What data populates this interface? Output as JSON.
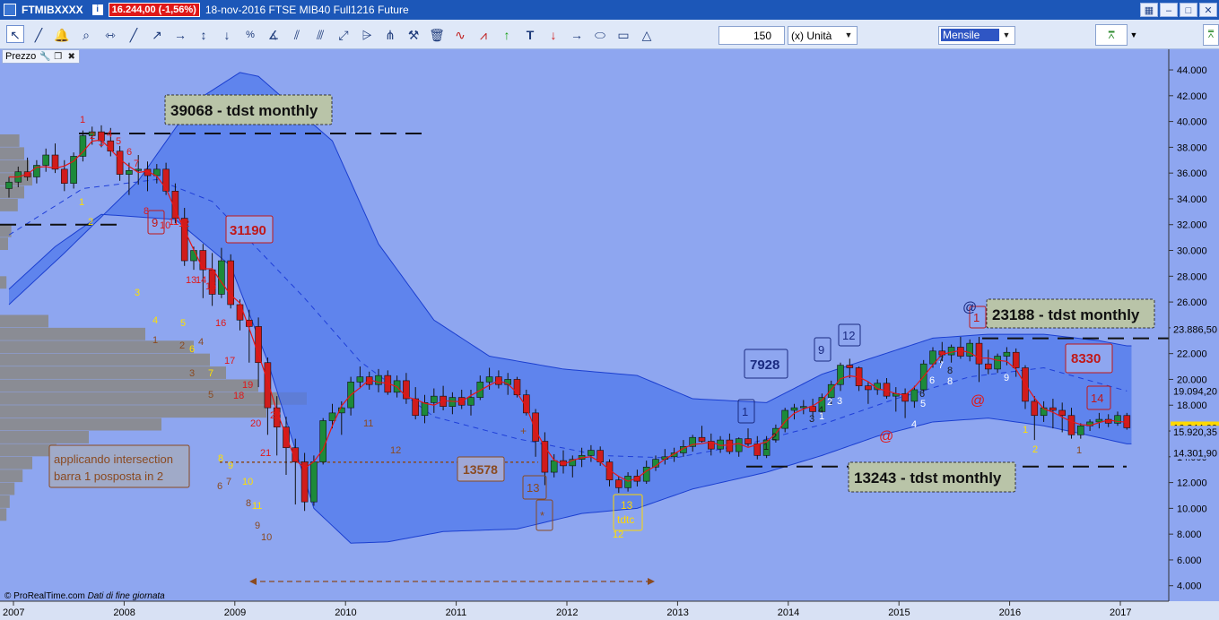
{
  "titlebar": {
    "symbol": "FTMIBXXXX",
    "price_badge": "16.244,00 (-1,56%)",
    "title": "18-nov-2016 FTSE MIB40 Full1216 Future",
    "window_buttons": [
      "▦",
      "–",
      "□",
      "✕"
    ]
  },
  "toolbar": {
    "units_value": "150",
    "units_label": "(x) Unità",
    "period": "Mensile",
    "tools": [
      "cursor-icon",
      "ruler-icon",
      "alarm-icon",
      "zoom-icon",
      "horizontal-line-icon",
      "trendline-icon",
      "ray-icon",
      "horizontal-ray-icon",
      "vertical-line-icon",
      "vertical-ray-icon",
      "percent-icon",
      "fibonacci-icon",
      "fan-icon",
      "channel-icon",
      "arrows-icon",
      "regression-icon",
      "pitchfork-icon",
      "tools-icon",
      "trash-icon",
      "wave-icon",
      "zigzag-icon",
      "up-arrow-icon",
      "text-icon",
      "down-arrow-icon",
      "right-arrow-icon",
      "ellipse-icon",
      "rectangle-icon",
      "triangle-icon"
    ]
  },
  "panel": {
    "label": "Prezzo"
  },
  "chart_data": {
    "type": "candlestick",
    "instrument": "FTSE MIB40 Full1216 Future",
    "period": "Mensile",
    "x_ticks": [
      "2007",
      "2008",
      "2009",
      "2010",
      "2011",
      "2012",
      "2013",
      "2014",
      "2015",
      "2016",
      "2017"
    ],
    "y_ticks": [
      "4.000",
      "6.000",
      "8.000",
      "10.000",
      "12.000",
      "14.000",
      "16.000",
      "18.000",
      "20.000",
      "22.000",
      "24.000",
      "26.000",
      "28.000",
      "30.000",
      "32.000",
      "34.000",
      "36.000",
      "38.000",
      "40.000",
      "42.000",
      "44.000"
    ],
    "ylim": [
      2800,
      45600
    ],
    "candles": [
      {
        "o": 34800,
        "h": 35700,
        "l": 34100,
        "c": 35300
      },
      {
        "o": 35300,
        "h": 36500,
        "l": 34900,
        "c": 36100
      },
      {
        "o": 36100,
        "h": 37200,
        "l": 35400,
        "c": 35700
      },
      {
        "o": 35700,
        "h": 37000,
        "l": 35200,
        "c": 36600
      },
      {
        "o": 36600,
        "h": 37900,
        "l": 36100,
        "c": 37400
      },
      {
        "o": 37400,
        "h": 38300,
        "l": 36000,
        "c": 36300
      },
      {
        "o": 36300,
        "h": 37000,
        "l": 34600,
        "c": 35200
      },
      {
        "o": 35200,
        "h": 37600,
        "l": 34800,
        "c": 37300
      },
      {
        "o": 37300,
        "h": 39300,
        "l": 36900,
        "c": 38900
      },
      {
        "o": 38900,
        "h": 39600,
        "l": 38200,
        "c": 39200
      },
      {
        "o": 39200,
        "h": 39700,
        "l": 38000,
        "c": 38500
      },
      {
        "o": 38500,
        "h": 39500,
        "l": 37300,
        "c": 37700
      },
      {
        "o": 37700,
        "h": 38100,
        "l": 35400,
        "c": 35900
      },
      {
        "o": 35900,
        "h": 36800,
        "l": 34300,
        "c": 36200
      },
      {
        "o": 36200,
        "h": 37400,
        "l": 35100,
        "c": 36300
      },
      {
        "o": 36300,
        "h": 36900,
        "l": 34600,
        "c": 35800
      },
      {
        "o": 35800,
        "h": 36700,
        "l": 35200,
        "c": 36300
      },
      {
        "o": 36300,
        "h": 36800,
        "l": 34300,
        "c": 34600
      },
      {
        "o": 34600,
        "h": 35200,
        "l": 32100,
        "c": 32500
      },
      {
        "o": 32500,
        "h": 33300,
        "l": 28800,
        "c": 29200
      },
      {
        "o": 29200,
        "h": 30300,
        "l": 28500,
        "c": 30000
      },
      {
        "o": 30000,
        "h": 30500,
        "l": 26300,
        "c": 28500
      },
      {
        "o": 28500,
        "h": 29800,
        "l": 25700,
        "c": 26600
      },
      {
        "o": 26600,
        "h": 30200,
        "l": 26300,
        "c": 29200
      },
      {
        "o": 29200,
        "h": 29700,
        "l": 25500,
        "c": 25800
      },
      {
        "o": 25800,
        "h": 26200,
        "l": 23800,
        "c": 24600
      },
      {
        "o": 24600,
        "h": 25400,
        "l": 21300,
        "c": 24100
      },
      {
        "o": 24100,
        "h": 24800,
        "l": 19400,
        "c": 21300
      },
      {
        "o": 21300,
        "h": 21700,
        "l": 15700,
        "c": 17800
      },
      {
        "o": 17800,
        "h": 18700,
        "l": 14100,
        "c": 16300
      },
      {
        "o": 16300,
        "h": 17100,
        "l": 12600,
        "c": 14700
      },
      {
        "o": 14700,
        "h": 15400,
        "l": 10300,
        "c": 13600
      },
      {
        "o": 13600,
        "h": 14300,
        "l": 9800,
        "c": 10500
      },
      {
        "o": 10500,
        "h": 14100,
        "l": 10200,
        "c": 13600
      },
      {
        "o": 13600,
        "h": 17000,
        "l": 13400,
        "c": 16800
      },
      {
        "o": 16800,
        "h": 18100,
        "l": 16200,
        "c": 17400
      },
      {
        "o": 17400,
        "h": 18300,
        "l": 15700,
        "c": 17800
      },
      {
        "o": 17800,
        "h": 20200,
        "l": 17200,
        "c": 19800
      },
      {
        "o": 19800,
        "h": 21000,
        "l": 19300,
        "c": 20200
      },
      {
        "o": 20200,
        "h": 20600,
        "l": 19200,
        "c": 19600
      },
      {
        "o": 19600,
        "h": 20800,
        "l": 19000,
        "c": 20300
      },
      {
        "o": 20300,
        "h": 20700,
        "l": 18800,
        "c": 19000
      },
      {
        "o": 19000,
        "h": 20300,
        "l": 18600,
        "c": 19900
      },
      {
        "o": 19900,
        "h": 20500,
        "l": 18100,
        "c": 18500
      },
      {
        "o": 18500,
        "h": 19400,
        "l": 16900,
        "c": 17200
      },
      {
        "o": 17200,
        "h": 18800,
        "l": 16600,
        "c": 18200
      },
      {
        "o": 18200,
        "h": 19300,
        "l": 17400,
        "c": 18700
      },
      {
        "o": 18700,
        "h": 19500,
        "l": 17600,
        "c": 17900
      },
      {
        "o": 17900,
        "h": 19000,
        "l": 17300,
        "c": 18600
      },
      {
        "o": 18600,
        "h": 19200,
        "l": 17700,
        "c": 18000
      },
      {
        "o": 18000,
        "h": 19200,
        "l": 17200,
        "c": 18600
      },
      {
        "o": 18600,
        "h": 20300,
        "l": 18400,
        "c": 19800
      },
      {
        "o": 19800,
        "h": 20900,
        "l": 19200,
        "c": 20200
      },
      {
        "o": 20200,
        "h": 20700,
        "l": 19300,
        "c": 19600
      },
      {
        "o": 19600,
        "h": 20500,
        "l": 18800,
        "c": 20000
      },
      {
        "o": 20000,
        "h": 20200,
        "l": 18600,
        "c": 18800
      },
      {
        "o": 18800,
        "h": 19200,
        "l": 17200,
        "c": 17400
      },
      {
        "o": 17400,
        "h": 17700,
        "l": 14000,
        "c": 15200
      },
      {
        "o": 15200,
        "h": 15900,
        "l": 11800,
        "c": 12800
      },
      {
        "o": 12800,
        "h": 14200,
        "l": 12400,
        "c": 13700
      },
      {
        "o": 13700,
        "h": 14500,
        "l": 12700,
        "c": 13300
      },
      {
        "o": 13300,
        "h": 14100,
        "l": 12400,
        "c": 13800
      },
      {
        "o": 13800,
        "h": 14700,
        "l": 13200,
        "c": 14100
      },
      {
        "o": 14100,
        "h": 14900,
        "l": 13600,
        "c": 14500
      },
      {
        "o": 14500,
        "h": 14800,
        "l": 13300,
        "c": 13600
      },
      {
        "o": 13600,
        "h": 13800,
        "l": 11700,
        "c": 12200
      },
      {
        "o": 12200,
        "h": 12500,
        "l": 11200,
        "c": 11600
      },
      {
        "o": 11600,
        "h": 12800,
        "l": 11300,
        "c": 12500
      },
      {
        "o": 12500,
        "h": 13000,
        "l": 11700,
        "c": 12100
      },
      {
        "o": 12100,
        "h": 13700,
        "l": 11900,
        "c": 13200
      },
      {
        "o": 13200,
        "h": 14100,
        "l": 12900,
        "c": 13800
      },
      {
        "o": 13800,
        "h": 14600,
        "l": 13400,
        "c": 14000
      },
      {
        "o": 14000,
        "h": 14700,
        "l": 13600,
        "c": 14300
      },
      {
        "o": 14300,
        "h": 15300,
        "l": 14000,
        "c": 14800
      },
      {
        "o": 14800,
        "h": 15700,
        "l": 14400,
        "c": 15500
      },
      {
        "o": 15500,
        "h": 16400,
        "l": 15100,
        "c": 15200
      },
      {
        "o": 15200,
        "h": 15800,
        "l": 14100,
        "c": 14600
      },
      {
        "o": 14600,
        "h": 15600,
        "l": 14300,
        "c": 15300
      },
      {
        "o": 15300,
        "h": 15800,
        "l": 14200,
        "c": 14400
      },
      {
        "o": 14400,
        "h": 15500,
        "l": 14000,
        "c": 15400
      },
      {
        "o": 15400,
        "h": 16200,
        "l": 14800,
        "c": 15000
      },
      {
        "o": 15000,
        "h": 15600,
        "l": 13800,
        "c": 14100
      },
      {
        "o": 14100,
        "h": 15600,
        "l": 13900,
        "c": 15300
      },
      {
        "o": 15300,
        "h": 16500,
        "l": 15100,
        "c": 16200
      },
      {
        "o": 16200,
        "h": 17800,
        "l": 15900,
        "c": 17600
      },
      {
        "o": 17600,
        "h": 18100,
        "l": 16900,
        "c": 17800
      },
      {
        "o": 17800,
        "h": 18400,
        "l": 17300,
        "c": 17900
      },
      {
        "o": 17900,
        "h": 18500,
        "l": 17100,
        "c": 17500
      },
      {
        "o": 17500,
        "h": 18900,
        "l": 17200,
        "c": 18600
      },
      {
        "o": 18600,
        "h": 19900,
        "l": 18000,
        "c": 19600
      },
      {
        "o": 19600,
        "h": 21300,
        "l": 19100,
        "c": 21100
      },
      {
        "o": 21100,
        "h": 21600,
        "l": 20100,
        "c": 20900
      },
      {
        "o": 20900,
        "h": 21000,
        "l": 19100,
        "c": 19500
      },
      {
        "o": 19500,
        "h": 19800,
        "l": 18100,
        "c": 19200
      },
      {
        "o": 19200,
        "h": 20000,
        "l": 18800,
        "c": 19700
      },
      {
        "o": 19700,
        "h": 20100,
        "l": 18500,
        "c": 18700
      },
      {
        "o": 18700,
        "h": 19400,
        "l": 17500,
        "c": 18900
      },
      {
        "o": 18900,
        "h": 19300,
        "l": 17000,
        "c": 18300
      },
      {
        "o": 18300,
        "h": 19500,
        "l": 17800,
        "c": 19200
      },
      {
        "o": 19200,
        "h": 21500,
        "l": 19000,
        "c": 21200
      },
      {
        "o": 21200,
        "h": 22500,
        "l": 20900,
        "c": 22200
      },
      {
        "o": 22200,
        "h": 22900,
        "l": 21400,
        "c": 21900
      },
      {
        "o": 21900,
        "h": 22700,
        "l": 21300,
        "c": 22500
      },
      {
        "o": 22500,
        "h": 23300,
        "l": 21600,
        "c": 21800
      },
      {
        "o": 21800,
        "h": 23100,
        "l": 21400,
        "c": 22800
      },
      {
        "o": 22800,
        "h": 23300,
        "l": 19800,
        "c": 21200
      },
      {
        "o": 21200,
        "h": 22300,
        "l": 20400,
        "c": 20800
      },
      {
        "o": 20800,
        "h": 22000,
        "l": 20500,
        "c": 21800
      },
      {
        "o": 21800,
        "h": 22500,
        "l": 21100,
        "c": 22100
      },
      {
        "o": 22100,
        "h": 22400,
        "l": 20200,
        "c": 20900
      },
      {
        "o": 20900,
        "h": 21100,
        "l": 17700,
        "c": 18300
      },
      {
        "o": 18300,
        "h": 18700,
        "l": 15300,
        "c": 17200
      },
      {
        "o": 17200,
        "h": 18300,
        "l": 16700,
        "c": 17800
      },
      {
        "o": 17800,
        "h": 18500,
        "l": 16200,
        "c": 17600
      },
      {
        "o": 17600,
        "h": 18200,
        "l": 15900,
        "c": 17200
      },
      {
        "o": 17200,
        "h": 17800,
        "l": 15400,
        "c": 15700
      },
      {
        "o": 15700,
        "h": 16600,
        "l": 15400,
        "c": 16400
      },
      {
        "o": 16400,
        "h": 16900,
        "l": 16000,
        "c": 16700
      },
      {
        "o": 16700,
        "h": 17400,
        "l": 16200,
        "c": 16900
      },
      {
        "o": 16900,
        "h": 17300,
        "l": 16300,
        "c": 16600
      },
      {
        "o": 16600,
        "h": 17500,
        "l": 16400,
        "c": 17200
      },
      {
        "o": 17200,
        "h": 17400,
        "l": 16100,
        "c": 16244
      }
    ],
    "upper_band": [
      [
        0,
        25800
      ],
      [
        6,
        29800
      ],
      [
        14,
        35400
      ],
      [
        20,
        41500
      ],
      [
        25,
        43800
      ],
      [
        27,
        43500
      ],
      [
        35,
        38500
      ],
      [
        40,
        30500
      ],
      [
        46,
        24600
      ],
      [
        52,
        21800
      ],
      [
        60,
        20800
      ],
      [
        68,
        20300
      ],
      [
        74,
        18500
      ],
      [
        82,
        18200
      ],
      [
        88,
        20400
      ],
      [
        94,
        21800
      ],
      [
        100,
        23200
      ],
      [
        106,
        23500
      ],
      [
        112,
        23500
      ],
      [
        118,
        23000
      ],
      [
        121,
        22600
      ]
    ],
    "lower_band": [
      [
        0,
        27000
      ],
      [
        5,
        30300
      ],
      [
        10,
        32800
      ],
      [
        18,
        32400
      ],
      [
        24,
        28800
      ],
      [
        28,
        21400
      ],
      [
        33,
        10000
      ],
      [
        37,
        7300
      ],
      [
        41,
        7400
      ],
      [
        47,
        8200
      ],
      [
        55,
        8400
      ],
      [
        62,
        9600
      ],
      [
        68,
        10000
      ],
      [
        74,
        11500
      ],
      [
        82,
        12800
      ],
      [
        88,
        14100
      ],
      [
        94,
        15600
      ],
      [
        100,
        16700
      ],
      [
        106,
        17000
      ],
      [
        112,
        16400
      ],
      [
        116,
        15800
      ],
      [
        121,
        15000
      ]
    ],
    "middle_band": [
      [
        0,
        31200
      ],
      [
        8,
        34800
      ],
      [
        16,
        35500
      ],
      [
        22,
        33800
      ],
      [
        28,
        29300
      ],
      [
        32,
        26300
      ],
      [
        38,
        21400
      ],
      [
        46,
        17100
      ],
      [
        55,
        15400
      ],
      [
        64,
        14100
      ],
      [
        72,
        13900
      ],
      [
        80,
        15000
      ],
      [
        88,
        16500
      ],
      [
        96,
        18500
      ],
      [
        104,
        20200
      ],
      [
        112,
        20900
      ],
      [
        121,
        19100
      ]
    ],
    "horizontal_levels": [
      {
        "value": 39068,
        "label": "39068 - tdst monthly"
      },
      {
        "value": 32000,
        "label": ""
      },
      {
        "value": 23188,
        "label": "23188 - tdst monthly"
      },
      {
        "value": 13243,
        "label": "13243 - tdst monthly"
      },
      {
        "value": 13578,
        "label": "13578"
      }
    ],
    "price_labels": [
      "23.886,50",
      "19.094,20",
      "16.244,00",
      "15.920,35",
      "14.301,90"
    ],
    "annotations": {
      "boxes": [
        "31190",
        "7928",
        "8330"
      ],
      "note": [
        "applicando intersection",
        "barra 1 posposta in 2"
      ],
      "td_boxed": [
        "9",
        "9",
        "1",
        "14",
        "1",
        "12",
        "13",
        "*",
        "13",
        "tdtc"
      ],
      "td_counts": [
        "1",
        "2",
        "3",
        "4",
        "5",
        "6",
        "7",
        "8",
        "9",
        "10",
        "11",
        "12",
        "13",
        "14",
        "15",
        "16",
        "17",
        "18",
        "19",
        "20",
        "21",
        "22",
        "1",
        "2",
        "3",
        "4",
        "5",
        "6",
        "7",
        "8",
        "9",
        "10",
        "11",
        "12",
        "1",
        "2",
        "3",
        "4",
        "5",
        "6",
        "7",
        "8",
        "9",
        "1",
        "2",
        "3",
        "4",
        "5",
        "6",
        "7",
        "8",
        "9",
        "@",
        "@",
        "@",
        "@",
        "+"
      ]
    },
    "footer": {
      "source": "© ProRealTime.com",
      "note": "Dati di fine giornata"
    }
  }
}
